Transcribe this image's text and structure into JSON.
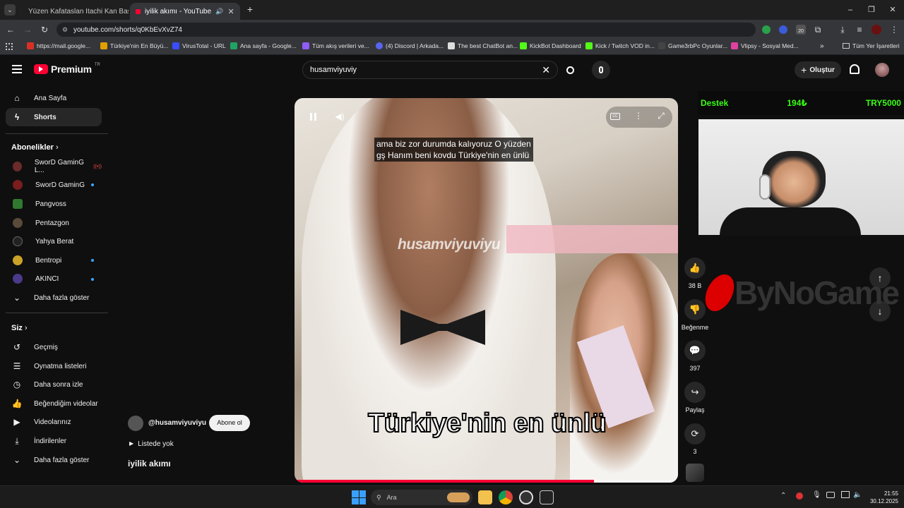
{
  "browser": {
    "tabs": [
      {
        "title": "Yüzen Kafataslan Itachi Kan Bas",
        "active": false
      },
      {
        "title": "iyilik akımı - YouTube",
        "active": true
      }
    ],
    "url": "youtube.com/shorts/q0KbEvXvZ74",
    "bookmarks": [
      "https://mail.google...",
      "Türkiye'nin En Büyü...",
      "VirusTotal - URL",
      "Ana sayfa - Google...",
      "Tüm akış verileri ve...",
      "(4) Discord | Arkada...",
      "The best ChatBot an...",
      "KickBot Dashboard",
      "Kick / Twitch VOD in...",
      "Game3rbPc Oyunlar...",
      "Vlipsy - Sosyal Med..."
    ],
    "all_bookmarks": "Tüm Yer İşaretleri",
    "profile_badge": "20"
  },
  "yt": {
    "logo": "Premium",
    "logo_sup": "TR",
    "search_value": "husamviyuviy",
    "create_label": "Oluştur"
  },
  "sidebar": {
    "main": [
      {
        "label": "Ana Sayfa",
        "icon": "home-icon"
      },
      {
        "label": "Shorts",
        "icon": "shorts-icon"
      }
    ],
    "subs_title": "Abonelikler",
    "subs": [
      {
        "label": "SworD GaminG L...",
        "color": "#6b2b2b"
      },
      {
        "label": "SworD GaminG",
        "color": "#7a1d1d"
      },
      {
        "label": "Pangvoss",
        "color": "#2f7a2f"
      },
      {
        "label": "Pentazgon",
        "color": "#5a4a3a"
      },
      {
        "label": "Yahya Berat",
        "color": "#222222"
      },
      {
        "label": "Bentropi",
        "color": "#c9a227"
      },
      {
        "label": "AKINCI",
        "color": "#4b3a8a"
      }
    ],
    "subs_more": "Daha fazla göster",
    "you_title": "Siz",
    "you": [
      {
        "label": "Geçmiş",
        "icon": "history-icon"
      },
      {
        "label": "Oynatma listeleri",
        "icon": "playlist-icon"
      },
      {
        "label": "Daha sonra izle",
        "icon": "clock-icon"
      },
      {
        "label": "Beğendiğim videolar",
        "icon": "thumb-up-icon"
      },
      {
        "label": "Videolarınız",
        "icon": "video-icon"
      },
      {
        "label": "İndirilenler",
        "icon": "download-icon"
      },
      {
        "label": "Daha fazla göster",
        "icon": "chevron-down-icon"
      }
    ]
  },
  "video": {
    "caption_line1": "ama biz zor durumda kalıyoruz O yüzden",
    "caption_line2": "gş Hanım beni kovdu Türkiye'nin en ünlü",
    "watermark": "husamviyuviyu",
    "burned_text": "Türkiye'nin en ünlü",
    "channel": "@husamviyuviyu",
    "subscribe": "Abone ol",
    "playlist": "Listede yok",
    "title": "iyilik akımı",
    "progress": 0.78
  },
  "actions": {
    "likes": "38 B",
    "dislike": "Beğenme",
    "comments": "397",
    "share": "Paylaş",
    "remix": "3"
  },
  "overlay": {
    "destek": "Destek",
    "amount1": "194₺",
    "amount2": "TRY5000",
    "sponsor": "ByNoGame"
  },
  "taskbar": {
    "search": "Ara",
    "time": "21:55",
    "date": "30.12.2025"
  }
}
